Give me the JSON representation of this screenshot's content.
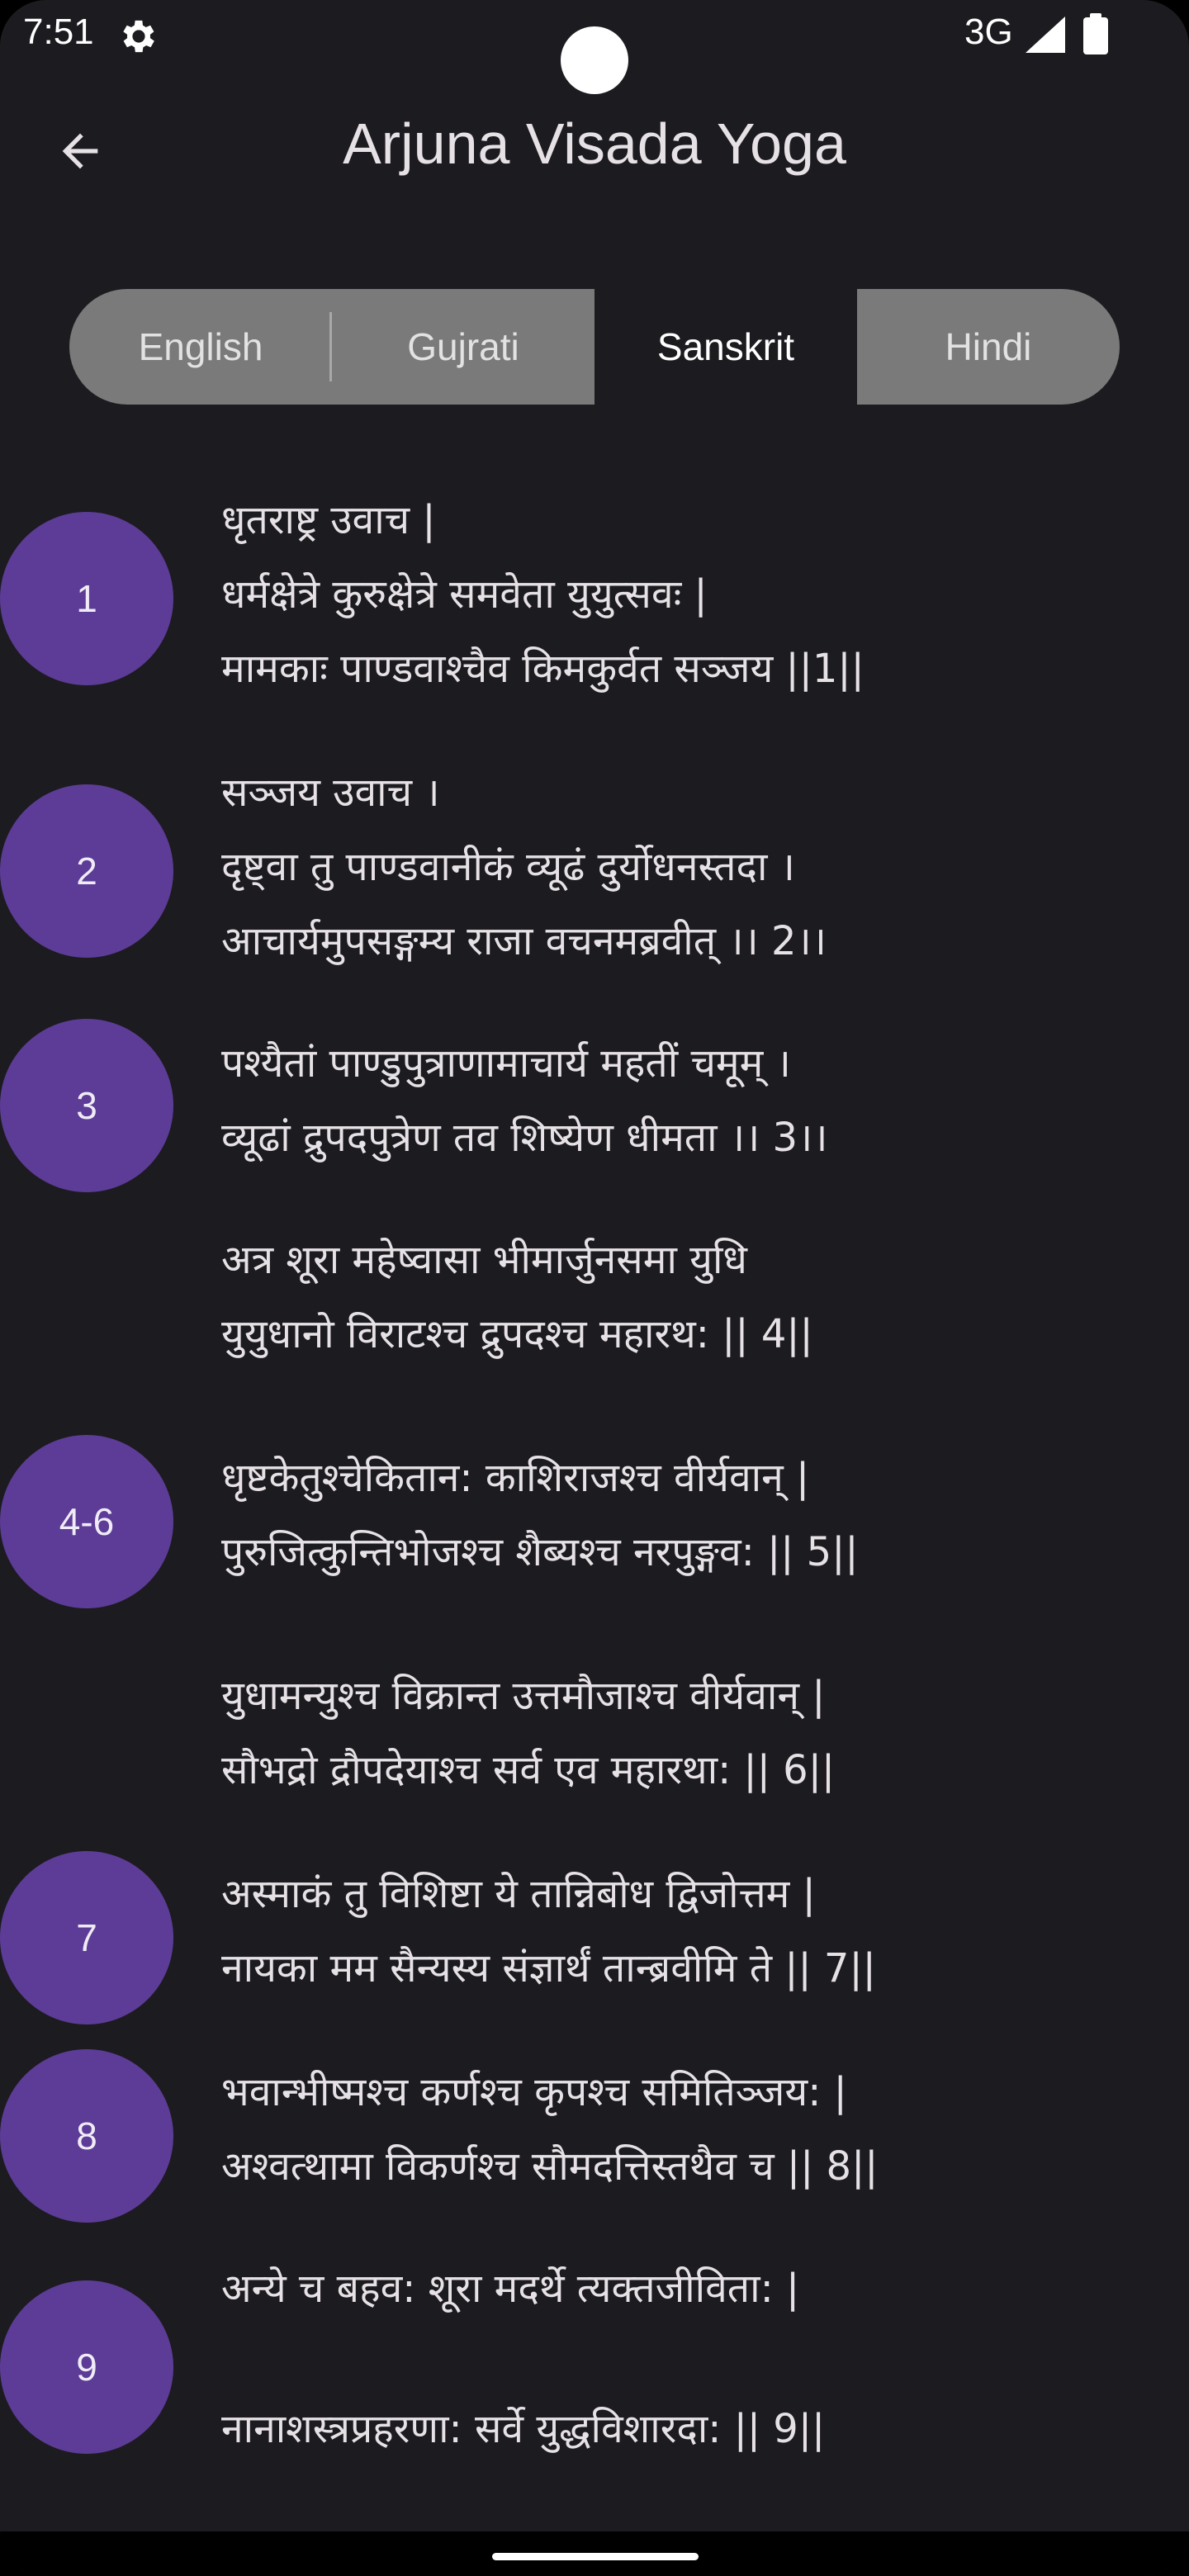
{
  "status_bar": {
    "time": "7:51",
    "network": "3G",
    "icons": [
      "gear-icon",
      "signal-icon",
      "battery-icon"
    ]
  },
  "app_bar": {
    "title": "Arjuna Visada Yoga",
    "back_icon": "arrow-left-icon"
  },
  "tabs": [
    {
      "label": "English",
      "selected": false
    },
    {
      "label": "Gujrati",
      "selected": false
    },
    {
      "label": "Sanskrit",
      "selected": true
    },
    {
      "label": "Hindi",
      "selected": false
    }
  ],
  "verses": [
    {
      "number": "1",
      "lines": [
        "धृतराष्ट्र उवाच |",
        "धर्मक्षेत्रे कुरुक्षेत्रे समवेता युयुत्सवः |",
        "मामकाः पाण्डवाश्चैव किमकुर्वत सञ्जय ||1||"
      ]
    },
    {
      "number": "2",
      "lines": [
        "सञ्जय उवाच ।",
        "दृष्ट्वा तु पाण्डवानीकं व्यूढं दुर्योधनस्तदा ।",
        "आचार्यमुपसङ्गम्य राजा वचनमब्रवीत् ।। 2।।"
      ]
    },
    {
      "number": "3",
      "lines": [
        "पश्यैतां पाण्डुपुत्राणामाचार्य महतीं चमूम् ।",
        "व्यूढां द्रुपदपुत्रेण तव शिष्येण धीमता ।। 3।।"
      ]
    },
    {
      "number": "4-6",
      "lines": [
        "अत्र शूरा महेष्वासा भीमार्जुनसमा युधि",
        "युयुधानो विराटश्च द्रुपदश्च महारथ: || 4||",
        "धृष्टकेतुश्चेकितान: काशिराजश्च वीर्यवान् |",
        "पुरुजित्कुन्तिभोजश्च शैब्यश्च नरपुङ्गव: || 5||",
        "युधामन्युश्च विक्रान्त उत्तमौजाश्च वीर्यवान् |",
        "सौभद्रो द्रौपदेयाश्च सर्व एव महारथा: || 6||"
      ]
    },
    {
      "number": "7",
      "lines": [
        "अस्माकं तु विशिष्टा ये तान्निबोध द्विजोत्तम |",
        "नायका मम सैन्यस्य संज्ञार्थं तान्ब्रवीमि ते || 7||"
      ]
    },
    {
      "number": "8",
      "lines": [
        "भवान्भीष्मश्च कर्णश्च कृपश्च समितिञ्जय: |",
        "अश्वत्थामा विकर्णश्च सौमदत्तिस्तथैव च || 8||"
      ]
    },
    {
      "number": "9",
      "lines": [
        "अन्ये च बहव: शूरा मदर्थे त्यक्तजीविता: |",
        "नानाशस्त्रप्रहरणा: सर्वे युद्धविशारदा: || 9||"
      ]
    }
  ],
  "colors": {
    "background": "#1c1b1f",
    "verse_badge": "#5c3c96",
    "tab_unselected": "#7a7a7a",
    "text": "#e6e1e5"
  }
}
